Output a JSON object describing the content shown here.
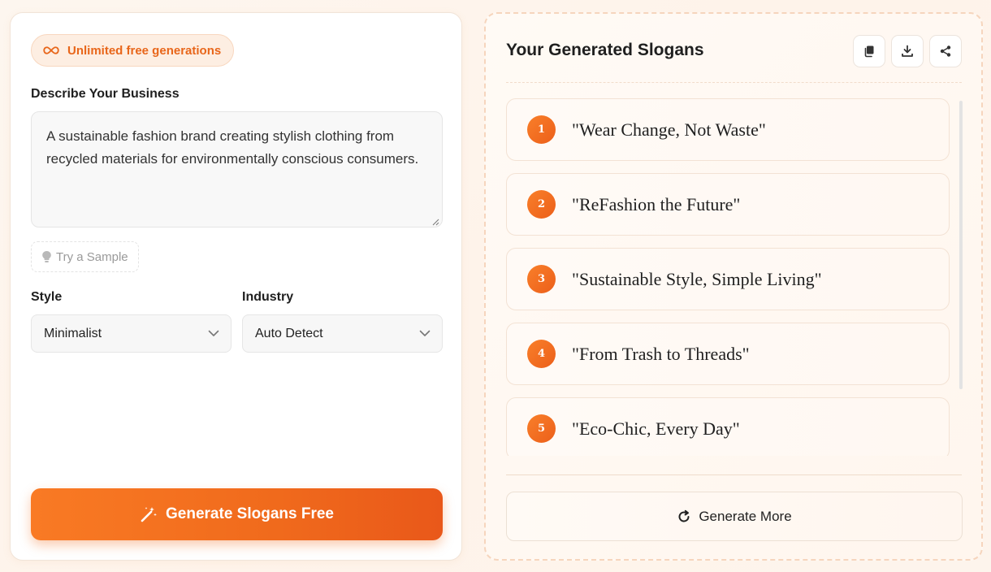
{
  "form": {
    "badge_text": "Unlimited free generations",
    "badge_icon": "infinity-icon",
    "description_label": "Describe Your Business",
    "description_value": "A sustainable fashion brand creating stylish clothing from recycled materials for environmentally conscious consumers.",
    "sample_button": "Try a Sample",
    "style_label": "Style",
    "style_value": "Minimalist",
    "industry_label": "Industry",
    "industry_value": "Auto Detect",
    "generate_button": "Generate Slogans Free"
  },
  "results": {
    "title": "Your Generated Slogans",
    "actions": [
      "copy-icon",
      "download-icon",
      "share-icon"
    ],
    "slogans": [
      {
        "number": "1",
        "text": "\"Wear Change, Not Waste\""
      },
      {
        "number": "2",
        "text": "\"ReFashion the Future\""
      },
      {
        "number": "3",
        "text": "\"Sustainable Style, Simple Living\""
      },
      {
        "number": "4",
        "text": "\"From Trash to Threads\""
      },
      {
        "number": "5",
        "text": "\"Eco-Chic, Every Day\""
      }
    ],
    "more_button": "Generate More"
  },
  "colors": {
    "accent": "#f97316",
    "accent_dark": "#ea580c",
    "badge_bg": "#fdeee2"
  }
}
